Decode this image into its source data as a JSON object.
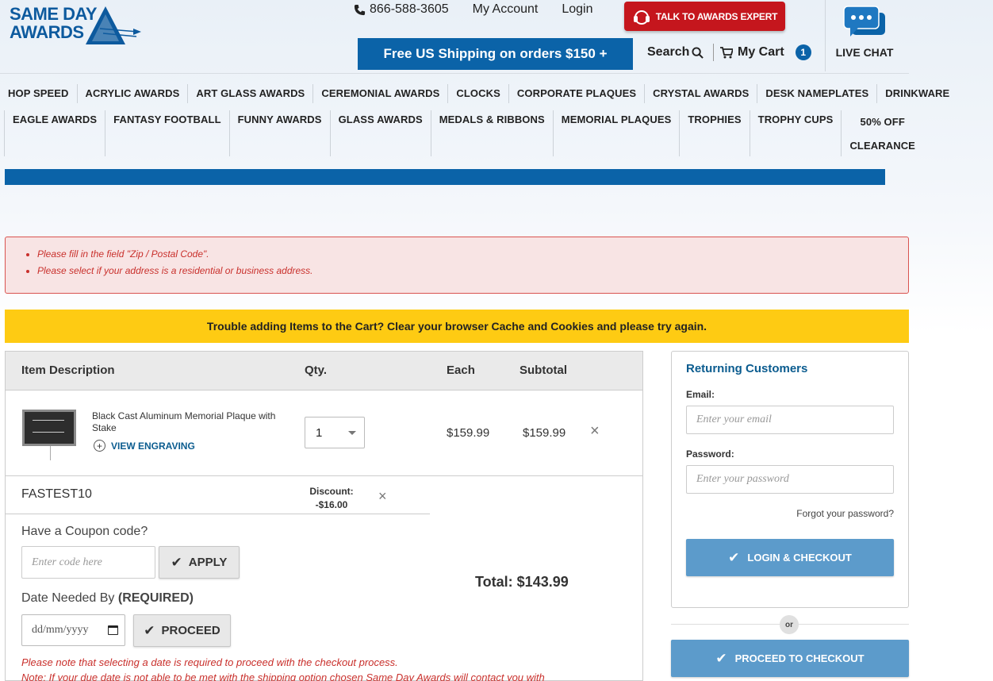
{
  "header": {
    "logo_line1": "SAME DAY",
    "logo_line2": "AWARDS",
    "phone": "866-588-3605",
    "my_account": "My Account",
    "login": "Login",
    "talk_button": "TALK TO AWARDS EXPERT",
    "shipping_banner": "Free US Shipping on orders $150 +",
    "search": "Search",
    "cart": "My Cart",
    "cart_count": "1",
    "live_chat": "LIVE CHAT"
  },
  "nav": {
    "row1": [
      "HOP SPEED",
      "ACRYLIC AWARDS",
      "ART GLASS AWARDS",
      "CEREMONIAL AWARDS",
      "CLOCKS",
      "CORPORATE PLAQUES",
      "CRYSTAL AWARDS",
      "DESK NAMEPLATES",
      "DRINKWARE"
    ],
    "row2": [
      "EAGLE AWARDS",
      "FANTASY FOOTBALL",
      "FUNNY AWARDS",
      "GLASS AWARDS",
      "MEDALS & RIBBONS",
      "MEMORIAL PLAQUES",
      "TROPHIES",
      "TROPHY CUPS"
    ],
    "clearance_line1": "50% OFF",
    "clearance_line2": "CLEARANCE"
  },
  "errors": [
    "Please fill in the field \"Zip / Postal Code\".",
    "Please select if your address is a residential or business address."
  ],
  "warning": "Trouble adding Items to the Cart? Clear your browser Cache and Cookies and please try again.",
  "cart": {
    "headers": {
      "description": "Item Description",
      "qty": "Qty.",
      "each": "Each",
      "subtotal": "Subtotal"
    },
    "item": {
      "name": "Black Cast Aluminum Memorial Plaque with Stake",
      "view_engraving": "VIEW ENGRAVING",
      "qty": "1",
      "each": "$159.99",
      "subtotal": "$159.99",
      "remove": "×"
    },
    "discount": {
      "code": "FASTEST10",
      "label": "Discount:",
      "amount": "-$16.00",
      "remove": "×"
    },
    "coupon_title": "Have a Coupon code?",
    "coupon_placeholder": "Enter code here",
    "apply": "APPLY",
    "date_title": "Date Needed By",
    "date_required": "(REQUIRED)",
    "date_placeholder": "dd/mm/yyyy",
    "proceed": "PROCEED",
    "total_label": "Total:",
    "total_value": "$143.99",
    "note1": "Please note that selecting a date is required to proceed with the checkout process.",
    "note2": "Note: If your due date is not able to be met with the shipping option chosen Same Day Awards will contact you with"
  },
  "login": {
    "title": "Returning Customers",
    "email_label": "Email:",
    "email_placeholder": "Enter your email",
    "password_label": "Password:",
    "password_placeholder": "Enter your password",
    "forgot": "Forgot your password?",
    "login_button": "LOGIN & CHECKOUT",
    "or": "or",
    "checkout_button": "PROCEED TO CHECKOUT"
  },
  "colors": {
    "brand_blue": "#0b63a8",
    "alert_red": "#c5161d",
    "warning_yellow": "#fecb13",
    "button_blue": "#5c9bcb"
  }
}
